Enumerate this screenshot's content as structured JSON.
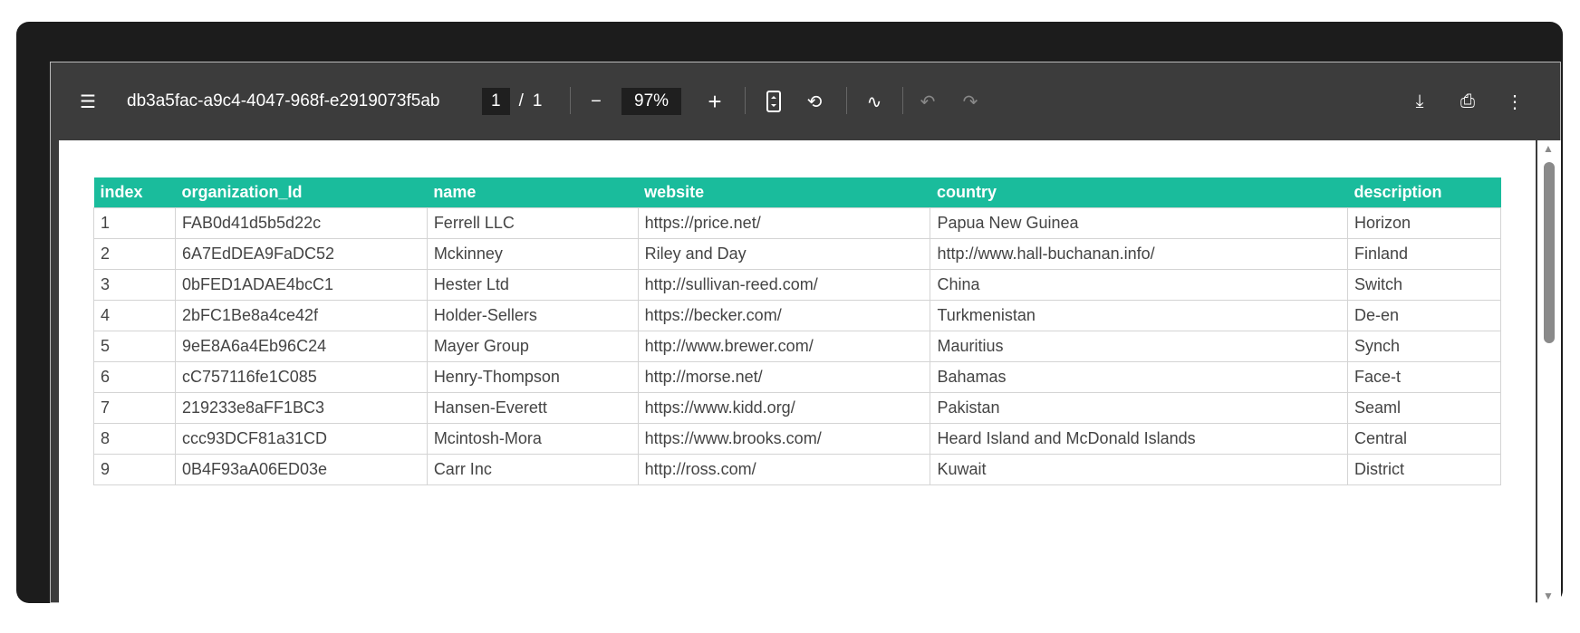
{
  "toolbar": {
    "title": "db3a5fac-a9c4-4047-968f-e2919073f5ab",
    "page_current": "1",
    "page_sep": "/",
    "page_total": "1",
    "zoom": "97%"
  },
  "icons": [
    "menu-icon",
    "zoom-out-icon",
    "zoom-in-icon",
    "fit-page-icon",
    "rotate-icon",
    "draw-icon",
    "undo-icon",
    "redo-icon",
    "download-icon",
    "print-icon",
    "more-icon"
  ],
  "colors": {
    "header": "#1abc9c",
    "toolbar": "#3c3c3c"
  },
  "table": {
    "headers": [
      "index",
      "organization_Id",
      "name",
      "website",
      "country",
      "description"
    ],
    "rows": [
      [
        "1",
        "FAB0d41d5b5d22c",
        "Ferrell LLC",
        "https://price.net/",
        "Papua New Guinea",
        "Horizon"
      ],
      [
        "2",
        "6A7EdDEA9FaDC52",
        "Mckinney",
        "Riley and Day",
        "http://www.hall-buchanan.info/",
        "Finland"
      ],
      [
        "3",
        "0bFED1ADAE4bcC1",
        "Hester Ltd",
        "http://sullivan-reed.com/",
        "China",
        "Switch"
      ],
      [
        "4",
        "2bFC1Be8a4ce42f",
        "Holder-Sellers",
        "https://becker.com/",
        "Turkmenistan",
        "De-en"
      ],
      [
        "5",
        "9eE8A6a4Eb96C24",
        "Mayer Group",
        "http://www.brewer.com/",
        "Mauritius",
        "Synch"
      ],
      [
        "6",
        "cC757116fe1C085",
        "Henry-Thompson",
        "http://morse.net/",
        "Bahamas",
        "Face-t"
      ],
      [
        "7",
        "219233e8aFF1BC3",
        "Hansen-Everett",
        "https://www.kidd.org/",
        "Pakistan",
        "Seaml"
      ],
      [
        "8",
        "ccc93DCF81a31CD",
        "Mcintosh-Mora",
        "https://www.brooks.com/",
        "Heard Island and McDonald Islands",
        "Central"
      ],
      [
        "9",
        "0B4F93aA06ED03e",
        "Carr Inc",
        "http://ross.com/",
        "Kuwait",
        "District"
      ]
    ]
  }
}
